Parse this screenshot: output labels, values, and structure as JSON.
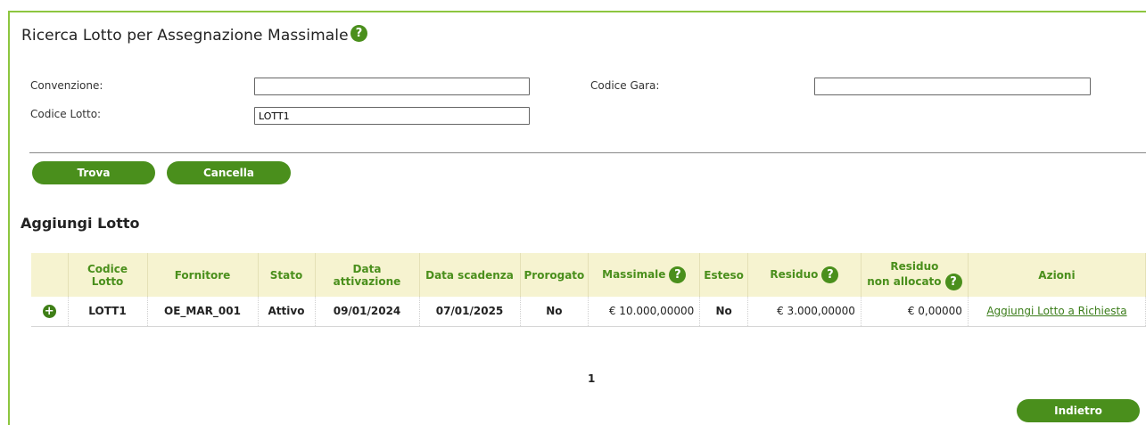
{
  "search": {
    "title": "Ricerca Lotto per Assegnazione Massimale",
    "help_glyph": "?",
    "fields": {
      "convenzione_label": "Convenzione:",
      "convenzione_value": "",
      "codice_gara_label": "Codice Gara:",
      "codice_gara_value": "",
      "codice_lotto_label": "Codice Lotto:",
      "codice_lotto_value": "LOTT1"
    },
    "buttons": {
      "find_label": "Trova",
      "clear_label": "Cancella"
    }
  },
  "results": {
    "title": "Aggiungi Lotto",
    "columns": {
      "codice_lotto": "Codice Lotto",
      "fornitore": "Fornitore",
      "stato": "Stato",
      "data_attivazione": "Data attivazione",
      "data_scadenza": "Data scadenza",
      "prorogato": "Prorogato",
      "massimale": "Massimale",
      "esteso": "Esteso",
      "residuo": "Residuo",
      "residuo_non_allocato_line1": "Residuo",
      "residuo_non_allocato_line2": "non allocato",
      "azioni": "Azioni"
    },
    "rows": [
      {
        "expand_glyph": "+",
        "codice_lotto": "LOTT1",
        "fornitore": "OE_MAR_001",
        "stato": "Attivo",
        "data_attivazione": "09/01/2024",
        "data_scadenza": "07/01/2025",
        "prorogato": "No",
        "massimale": "€ 10.000,00000",
        "esteso": "No",
        "residuo": "€ 3.000,00000",
        "residuo_non_allocato": "€ 0,00000",
        "azione": "Aggiungi Lotto a Richiesta"
      }
    ],
    "pagination": {
      "current_page": "1"
    }
  },
  "footer": {
    "back_label": "Indietro"
  },
  "colors": {
    "accent": "#4a8f1c",
    "border": "#8dc63f",
    "header_bg": "#f6f3d0"
  },
  "icons": [
    "help-icon",
    "plus-circle-icon"
  ]
}
